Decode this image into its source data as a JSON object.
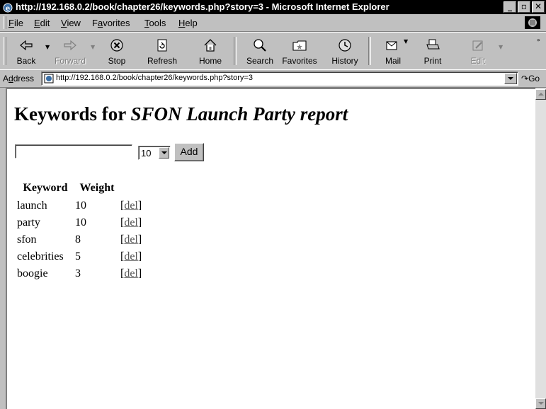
{
  "window": {
    "title": "http://192.168.0.2/book/chapter26/keywords.php?story=3 - Microsoft Internet Explorer"
  },
  "menu": [
    {
      "pre": "",
      "key": "F",
      "post": "ile"
    },
    {
      "pre": "",
      "key": "E",
      "post": "dit"
    },
    {
      "pre": "",
      "key": "V",
      "post": "iew"
    },
    {
      "pre": "F",
      "key": "a",
      "post": "vorites"
    },
    {
      "pre": "",
      "key": "T",
      "post": "ools"
    },
    {
      "pre": "",
      "key": "H",
      "post": "elp"
    }
  ],
  "toolbar": {
    "back": "Back",
    "forward": "Forward",
    "stop": "Stop",
    "refresh": "Refresh",
    "home": "Home",
    "search": "Search",
    "favorites": "Favorites",
    "history": "History",
    "mail": "Mail",
    "print": "Print",
    "edit": "Edit"
  },
  "address": {
    "label_pre": "A",
    "label_key": "d",
    "label_post": "dress",
    "url": "http://192.168.0.2/book/chapter26/keywords.php?story=3",
    "go": "Go"
  },
  "page": {
    "heading_prefix": "Keywords for ",
    "heading_story": "SFON Launch Party report",
    "form": {
      "keyword_value": "",
      "weight_selected": "10",
      "add_label": "Add"
    },
    "table": {
      "headers": [
        "Keyword",
        "Weight"
      ],
      "rows": [
        {
          "keyword": "launch",
          "weight": "10",
          "action": "del"
        },
        {
          "keyword": "party",
          "weight": "10",
          "action": "del"
        },
        {
          "keyword": "sfon",
          "weight": "8",
          "action": "del"
        },
        {
          "keyword": "celebrities",
          "weight": "5",
          "action": "del"
        },
        {
          "keyword": "boogie",
          "weight": "3",
          "action": "del"
        }
      ]
    }
  }
}
